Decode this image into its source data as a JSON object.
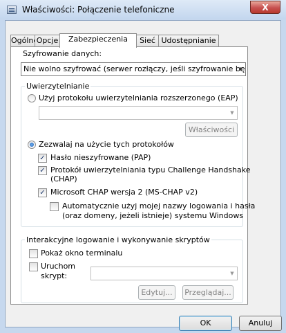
{
  "window": {
    "title": "Właściwości: Połączenie telefoniczne",
    "close_label": "X"
  },
  "tabs": [
    "Ogólne",
    "Opcje",
    "Zabezpieczenia",
    "Sieć",
    "Udostępnianie"
  ],
  "active_tab": "Zabezpieczenia",
  "encryption": {
    "label": "Szyfrowanie danych:",
    "value": "Nie wolno szyfrować (serwer rozłączy, jeśli szyfrowanie będzie wymagane)"
  },
  "auth": {
    "group_label": "Uwierzytelnianie",
    "eap_label": "Użyj protokołu uwierzytelniania rozszerzonego (EAP)",
    "eap_checked": false,
    "eap_select_value": "",
    "properties_label": "Właściwości",
    "allow_label": "Zezwalaj na użycie tych protokołów",
    "allow_checked": true,
    "pap_label": "Hasło nieszyfrowane (PAP)",
    "pap_checked": true,
    "chap_label_line1": "Protokół uwierzytelniania typu Challenge Handshake",
    "chap_label_line2": "(CHAP)",
    "chap_checked": true,
    "mschap_label": "Microsoft CHAP wersja 2 (MS-CHAP v2)",
    "mschap_checked": true,
    "auto_login_line1": "Automatycznie użyj mojej nazwy logowania i hasła",
    "auto_login_line2": "(oraz domeny, jeżeli istnieje) systemu Windows",
    "auto_login_checked": false
  },
  "scripting": {
    "group_label": "Interakcyjne logowanie i wykonywanie skryptów",
    "show_terminal_label": "Pokaż okno terminalu",
    "show_terminal_checked": false,
    "run_script_label_line1": "Uruchom",
    "run_script_label_line2": "skrypt:",
    "run_script_checked": false,
    "script_value": "",
    "edit_label": "Edytuj...",
    "browse_label": "Przeglądaj..."
  },
  "footer": {
    "ok_label": "OK",
    "cancel_label": "Anuluj"
  },
  "icons": {
    "dropdown": "chevron-down-icon",
    "check": "checkmark-icon"
  }
}
